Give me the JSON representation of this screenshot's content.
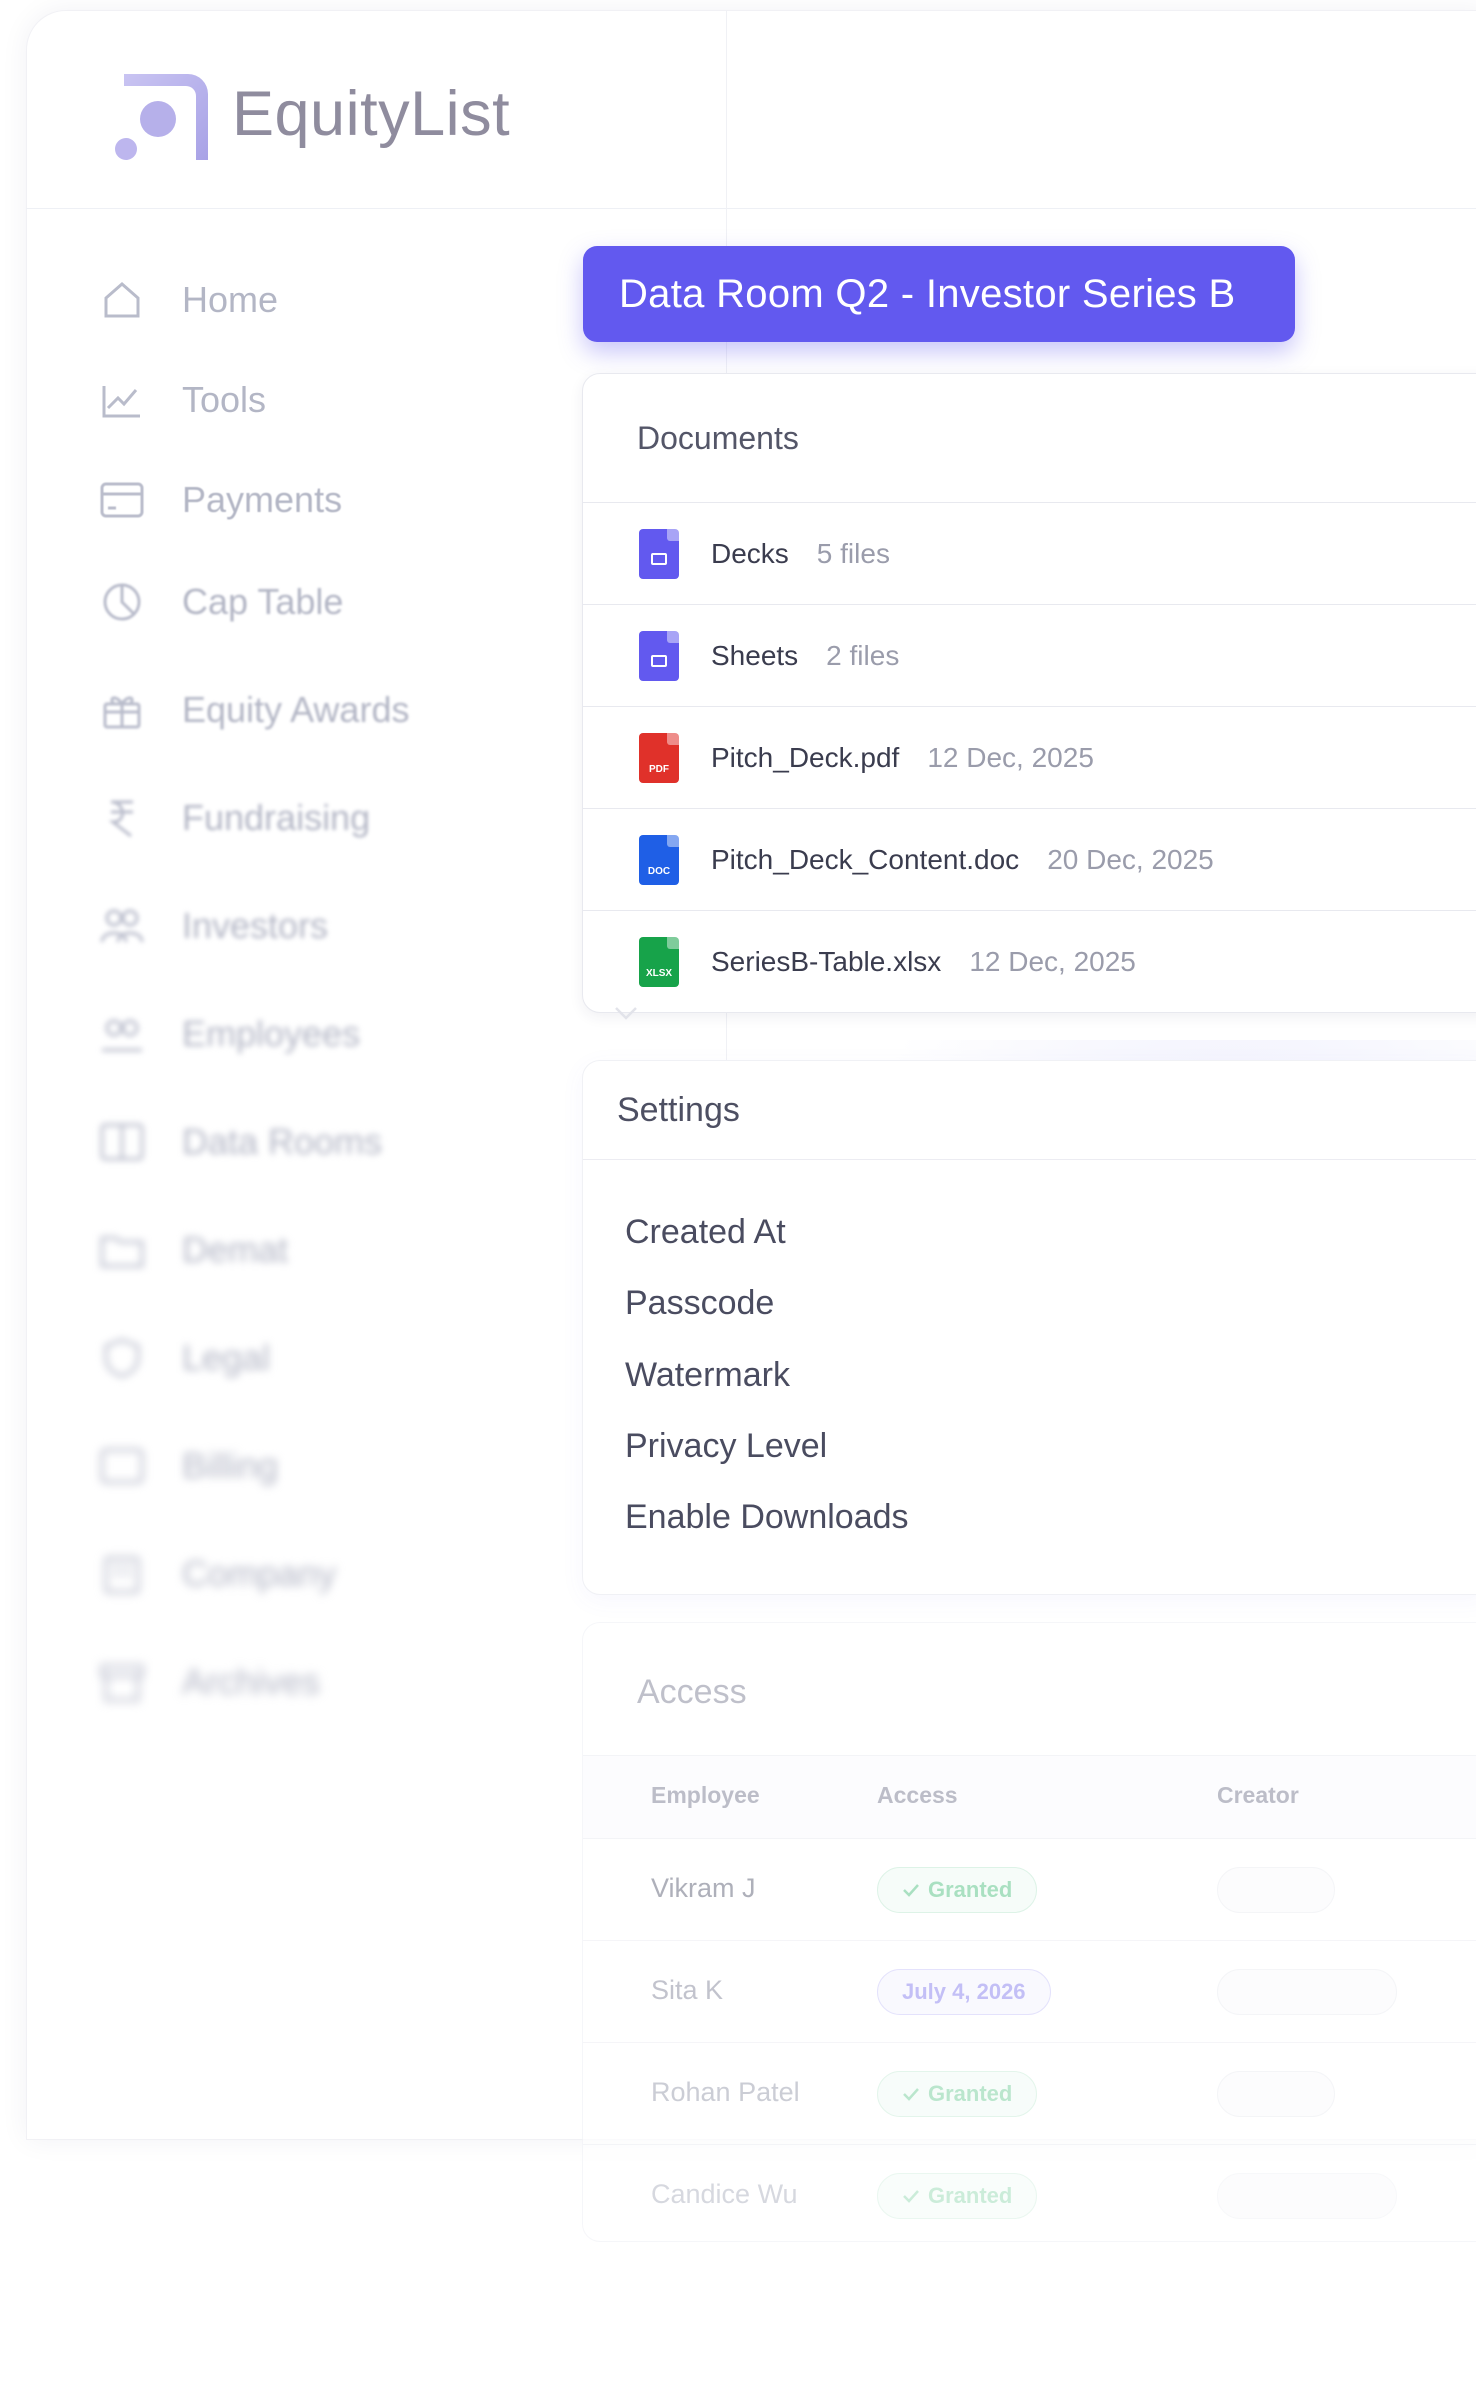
{
  "app": {
    "logo_text": "EquityList"
  },
  "sidebar": {
    "items": [
      {
        "label": "Home",
        "icon": "home-icon"
      },
      {
        "label": "Tools",
        "icon": "chart-line-icon"
      },
      {
        "label": "Payments",
        "icon": "credit-card-icon"
      },
      {
        "label": "Cap Table",
        "icon": "pie-chart-icon"
      },
      {
        "label": "Equity Awards",
        "icon": "gift-icon"
      },
      {
        "label": "Fundraising",
        "icon": "rupee-icon"
      },
      {
        "label": "Investors",
        "icon": "users-icon"
      },
      {
        "label": "Employees",
        "icon": "team-icon"
      },
      {
        "label": "Data Rooms",
        "icon": "data-room-icon"
      },
      {
        "label": "Demat",
        "icon": "folder-icon"
      },
      {
        "label": "Legal",
        "icon": "shield-icon"
      },
      {
        "label": "Billing",
        "icon": "billing-icon"
      },
      {
        "label": "Company",
        "icon": "building-icon"
      },
      {
        "label": "Archives",
        "icon": "archive-icon"
      }
    ]
  },
  "data_room": {
    "title": "Data Room Q2 - Investor Series B"
  },
  "documents": {
    "title": "Documents",
    "rows": [
      {
        "name": "Decks",
        "meta": "5 files",
        "type": "folder",
        "color": "#6259ef"
      },
      {
        "name": "Sheets",
        "meta": "2 files",
        "type": "folder",
        "color": "#6259ef"
      },
      {
        "name": "Pitch_Deck.pdf",
        "meta": "12 Dec, 2025",
        "type": "PDF",
        "color": "#e0312a"
      },
      {
        "name": "Pitch_Deck_Content.doc",
        "meta": "20 Dec, 2025",
        "type": "DOC",
        "color": "#1f5fe6"
      },
      {
        "name": "SeriesB-Table.xlsx",
        "meta": "12 Dec, 2025",
        "type": "XLSX",
        "color": "#17a34a"
      }
    ]
  },
  "settings": {
    "title": "Settings",
    "items": [
      "Created At",
      "Passcode",
      "Watermark",
      "Privacy Level",
      "Enable Downloads"
    ]
  },
  "access": {
    "title": "Access",
    "columns": [
      "Employee",
      "Access",
      "Creator"
    ],
    "rows": [
      {
        "employee": "Vikram J",
        "access": "Granted",
        "status": "granted"
      },
      {
        "employee": "Sita K",
        "access": "July 4, 2026",
        "status": "date"
      },
      {
        "employee": "Rohan Patel",
        "access": "Granted",
        "status": "granted"
      },
      {
        "employee": "Candice Wu",
        "access": "Granted",
        "status": "granted"
      }
    ]
  },
  "colors": {
    "accent": "#6259ef",
    "granted": "#86d4a8"
  }
}
